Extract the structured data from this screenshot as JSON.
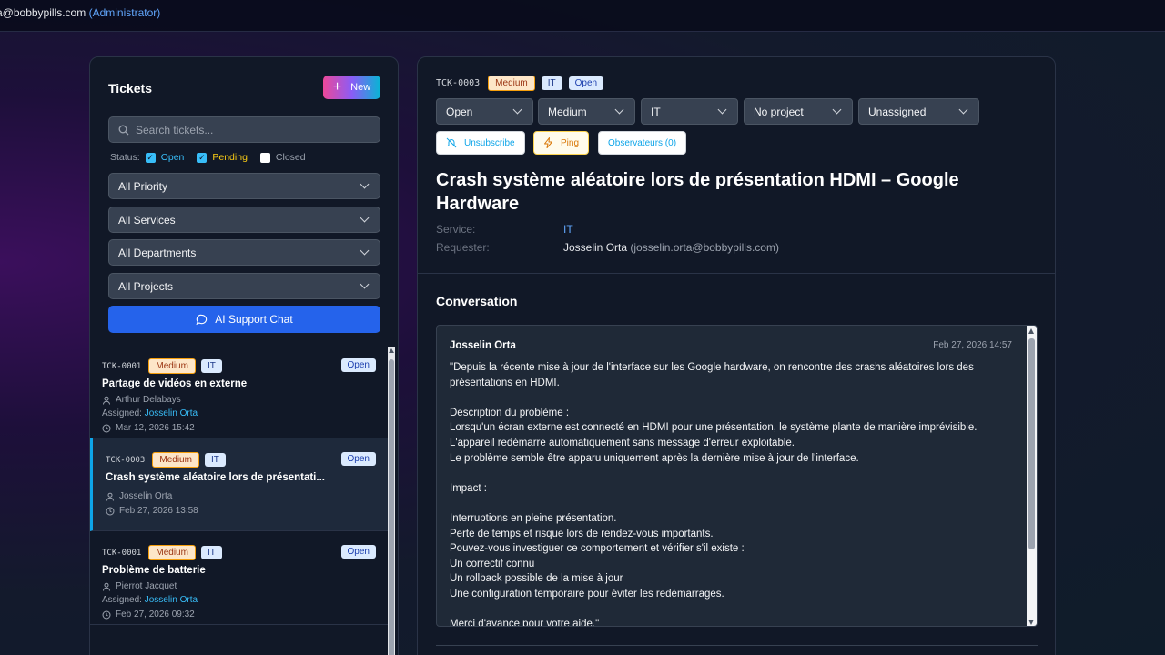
{
  "topbar": {
    "email": "a@bobbypills.com",
    "role": "(Administrator)"
  },
  "sidebar": {
    "title": "Tickets",
    "new_label": "New",
    "search_placeholder": "Search tickets...",
    "status_label": "Status:",
    "status_filters": [
      {
        "label": "Open",
        "checked": true
      },
      {
        "label": "Pending",
        "checked": true
      },
      {
        "label": "Closed",
        "checked": false
      }
    ],
    "filters": {
      "priority": "All Priority",
      "services": "All Services",
      "departments": "All Departments",
      "projects": "All Projects"
    },
    "ai_chat_label": "AI Support Chat",
    "assigned_label": "Assigned:",
    "tickets": [
      {
        "id": "TCK-0001",
        "priority": "Medium",
        "service": "IT",
        "status": "Open",
        "title": "Partage de vidéos en externe",
        "requester": "Arthur Delabays",
        "assignee": "Josselin Orta",
        "date": "Mar 12, 2026 15:42"
      },
      {
        "id": "TCK-0003",
        "priority": "Medium",
        "service": "IT",
        "status": "Open",
        "title": "Crash système aléatoire lors de présentati...",
        "requester": "Josselin Orta",
        "assignee": "",
        "date": "Feb 27, 2026 13:58"
      },
      {
        "id": "TCK-0001",
        "priority": "Medium",
        "service": "IT",
        "status": "Open",
        "title": "Problème de batterie",
        "requester": "Pierrot Jacquet",
        "assignee": "Josselin Orta",
        "date": "Feb 27, 2026 09:32"
      }
    ]
  },
  "detail": {
    "id": "TCK-0003",
    "priority_badge": "Medium",
    "service_badge": "IT",
    "status_badge": "Open",
    "dropdowns": {
      "status": "Open",
      "priority": "Medium",
      "service": "IT",
      "project": "No project",
      "assignee": "Unassigned"
    },
    "actions": {
      "unsubscribe": "Unsubscribe",
      "ping": "Ping",
      "observers": "Observateurs (0)"
    },
    "title": "Crash système aléatoire lors de présentation HDMI – Google Hardware",
    "service_label": "Service:",
    "service_value": "IT",
    "requester_label": "Requester:",
    "requester_name": "Josselin Orta",
    "requester_email": "(josselin.orta@bobbypills.com)",
    "conversation_title": "Conversation",
    "message": {
      "author": "Josselin Orta",
      "date": "Feb 27, 2026 14:57",
      "body": "\"Depuis la récente mise à jour de l'interface sur les Google hardware, on rencontre des crashs aléatoires lors des présentations en HDMI.\n\nDescription du problème :\nLorsqu'un écran externe est connecté en HDMI pour une présentation, le système plante de manière imprévisible.\nL'appareil redémarre automatiquement sans message d'erreur exploitable.\nLe problème semble être apparu uniquement après la dernière mise à jour de l'interface.\n\nImpact :\n\nInterruptions en pleine présentation.\nPerte de temps et risque lors de rendez-vous importants.\nPouvez-vous investiguer ce comportement et vérifier s'il existe :\nUn correctif connu\nUn rollback possible de la mise à jour\nUne configuration temporaire pour éviter les redémarrages.\n\nMerci d'avance pour votre aide.\""
    }
  }
}
